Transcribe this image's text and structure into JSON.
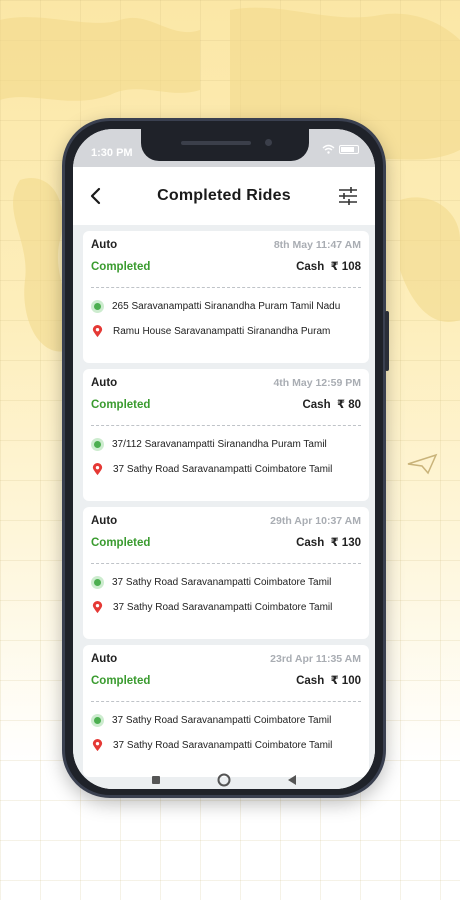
{
  "status_bar": {
    "time": "1:30 PM",
    "battery": "84"
  },
  "header": {
    "title": "Completed Rides"
  },
  "rides": [
    {
      "type": "Auto",
      "datetime": "8th May 11:47 AM",
      "status": "Completed",
      "payment": "Cash",
      "amount": "₹ 108",
      "pickup": "265  Saravanampatti Siranandha Puram Tamil Nadu",
      "drop": "Ramu House  Saravanampatti Siranandha Puram"
    },
    {
      "type": "Auto",
      "datetime": "4th May 12:59 PM",
      "status": "Completed",
      "payment": "Cash",
      "amount": "₹ 80",
      "pickup": "37/112  Saravanampatti Siranandha Puram Tamil",
      "drop": "37 Sathy Road Saravanampatti Coimbatore Tamil"
    },
    {
      "type": "Auto",
      "datetime": "29th Apr 10:37 AM",
      "status": "Completed",
      "payment": "Cash",
      "amount": "₹ 130",
      "pickup": "37 Sathy Road Saravanampatti Coimbatore Tamil",
      "drop": "37 Sathy Road Saravanampatti Coimbatore Tamil"
    },
    {
      "type": "Auto",
      "datetime": "23rd Apr 11:35 AM",
      "status": "Completed",
      "payment": "Cash",
      "amount": "₹ 100",
      "pickup": "37 Sathy Road Saravanampatti Coimbatore Tamil",
      "drop": "37 Sathy Road Saravanampatti Coimbatore Tamil"
    }
  ],
  "icons": {
    "back": "chevron-left-icon",
    "filter": "sliders-icon",
    "pickup": "green-dot-icon",
    "drop": "location-pin-icon"
  },
  "colors": {
    "completed": "#3a9b2f",
    "pickup": "#4caf50",
    "drop": "#e53935",
    "background": "#fbe7a6"
  }
}
